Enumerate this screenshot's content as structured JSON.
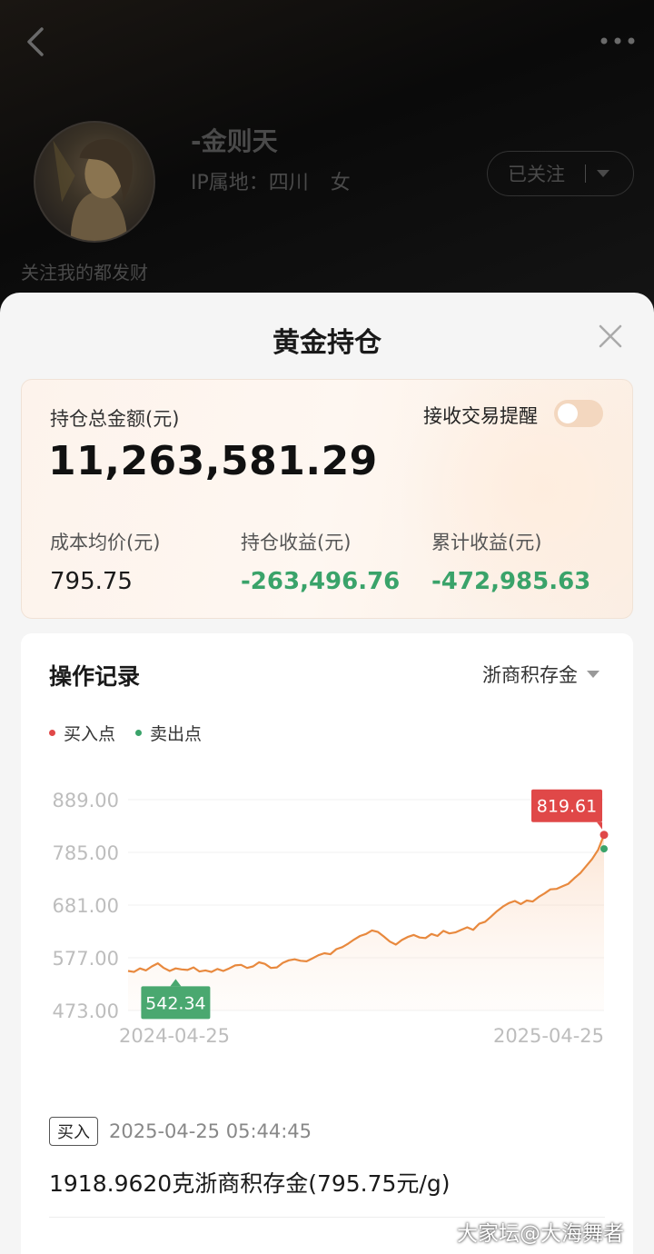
{
  "profile": {
    "name": "-金则天",
    "ip_location": "IP属地：四川",
    "gender": "女",
    "follow_label": "已关注",
    "bio": "关注我的都发财"
  },
  "sheet": {
    "title": "黄金持仓"
  },
  "summary": {
    "total_label": "持仓总金额(元)",
    "total_value": "11,263,581.29",
    "alert_label": "接收交易提醒",
    "alert_enabled": false,
    "cost_label": "成本均价(元)",
    "cost_value": "795.75",
    "holding_profit_label": "持仓收益(元)",
    "holding_profit_value": "-263,496.76",
    "total_profit_label": "累计收益(元)",
    "total_profit_value": "-472,985.63",
    "colors": {
      "loss": "#3aa36a",
      "accent": "#e86a2a"
    }
  },
  "records": {
    "title": "操作记录",
    "fund_selected": "浙商积存金",
    "legend": {
      "buy": "买入点",
      "sell": "卖出点",
      "buy_color": "#e04848",
      "sell_color": "#3aa36a"
    },
    "items": [
      {
        "tag": "买入",
        "time": "2025-04-25 05:44:45",
        "desc": "1918.9620克浙商积存金(795.75元/g)"
      }
    ]
  },
  "chart_data": {
    "type": "line",
    "y_ticks": [
      "889.00",
      "785.00",
      "681.00",
      "577.00",
      "473.00"
    ],
    "ylim": [
      473,
      889
    ],
    "x_ticks": [
      "2024-04-25",
      "2025-04-25"
    ],
    "x_range": [
      "2024-04-25",
      "2025-04-25"
    ],
    "grid": true,
    "max_label": "819.61",
    "min_label": "542.34",
    "series": [
      {
        "values": [
          551,
          549,
          556,
          552,
          560,
          566,
          557,
          551,
          556,
          554,
          553,
          558,
          550,
          552,
          549,
          555,
          551,
          556,
          562,
          563,
          557,
          560,
          568,
          565,
          557,
          558,
          567,
          572,
          574,
          571,
          570,
          576,
          582,
          586,
          584,
          594,
          598,
          605,
          613,
          620,
          624,
          631,
          628,
          619,
          609,
          603,
          612,
          618,
          622,
          617,
          616,
          624,
          620,
          630,
          625,
          627,
          632,
          637,
          632,
          644,
          648,
          658,
          669,
          678,
          685,
          689,
          683,
          690,
          688,
          697,
          704,
          712,
          713,
          718,
          723,
          734,
          744,
          758,
          772,
          790,
          819.61
        ]
      }
    ],
    "markers": [
      {
        "kind": "buy",
        "value": 819.61,
        "label": "819.61"
      },
      {
        "kind": "sell",
        "value": 792
      },
      {
        "kind": "min",
        "value": 542.34,
        "label": "542.34"
      }
    ]
  },
  "watermark": "大家坛@大海舞者"
}
